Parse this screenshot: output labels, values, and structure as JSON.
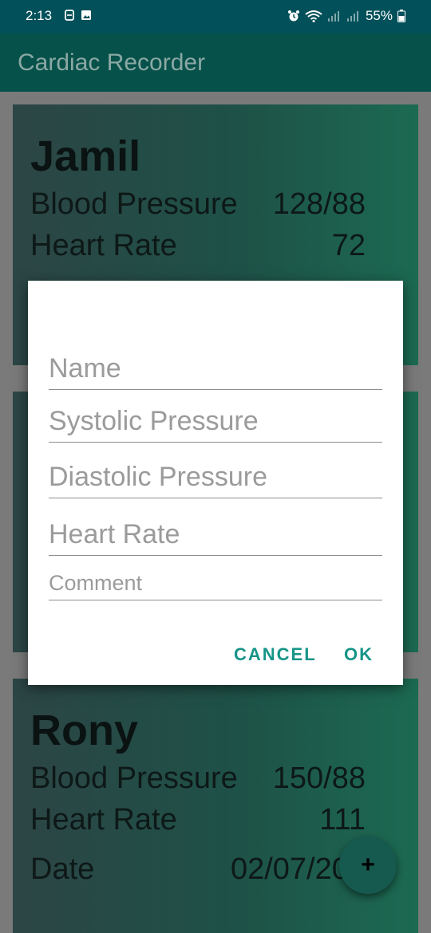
{
  "status": {
    "time": "2:13",
    "battery": "55%"
  },
  "app": {
    "title": "Cardiac Recorder"
  },
  "cards": [
    {
      "name": "Jamil",
      "bp_label": "Blood Pressure",
      "bp_value": "128/88",
      "hr_label": "Heart Rate",
      "hr_value": "72"
    },
    {
      "name": "Rony",
      "bp_label": "Blood Pressure",
      "bp_value": "150/88",
      "hr_label": "Heart Rate",
      "hr_value": "111",
      "date_label": "Date",
      "date_value": "02/07/202"
    }
  ],
  "dialog": {
    "fields": [
      {
        "placeholder": "Name"
      },
      {
        "placeholder": "Systolic Pressure"
      },
      {
        "placeholder": "Diastolic Pressure"
      },
      {
        "placeholder": "Heart Rate"
      },
      {
        "placeholder": "Comment"
      }
    ],
    "cancel_label": "CANCEL",
    "ok_label": "OK"
  },
  "fab": {
    "label": "+"
  }
}
